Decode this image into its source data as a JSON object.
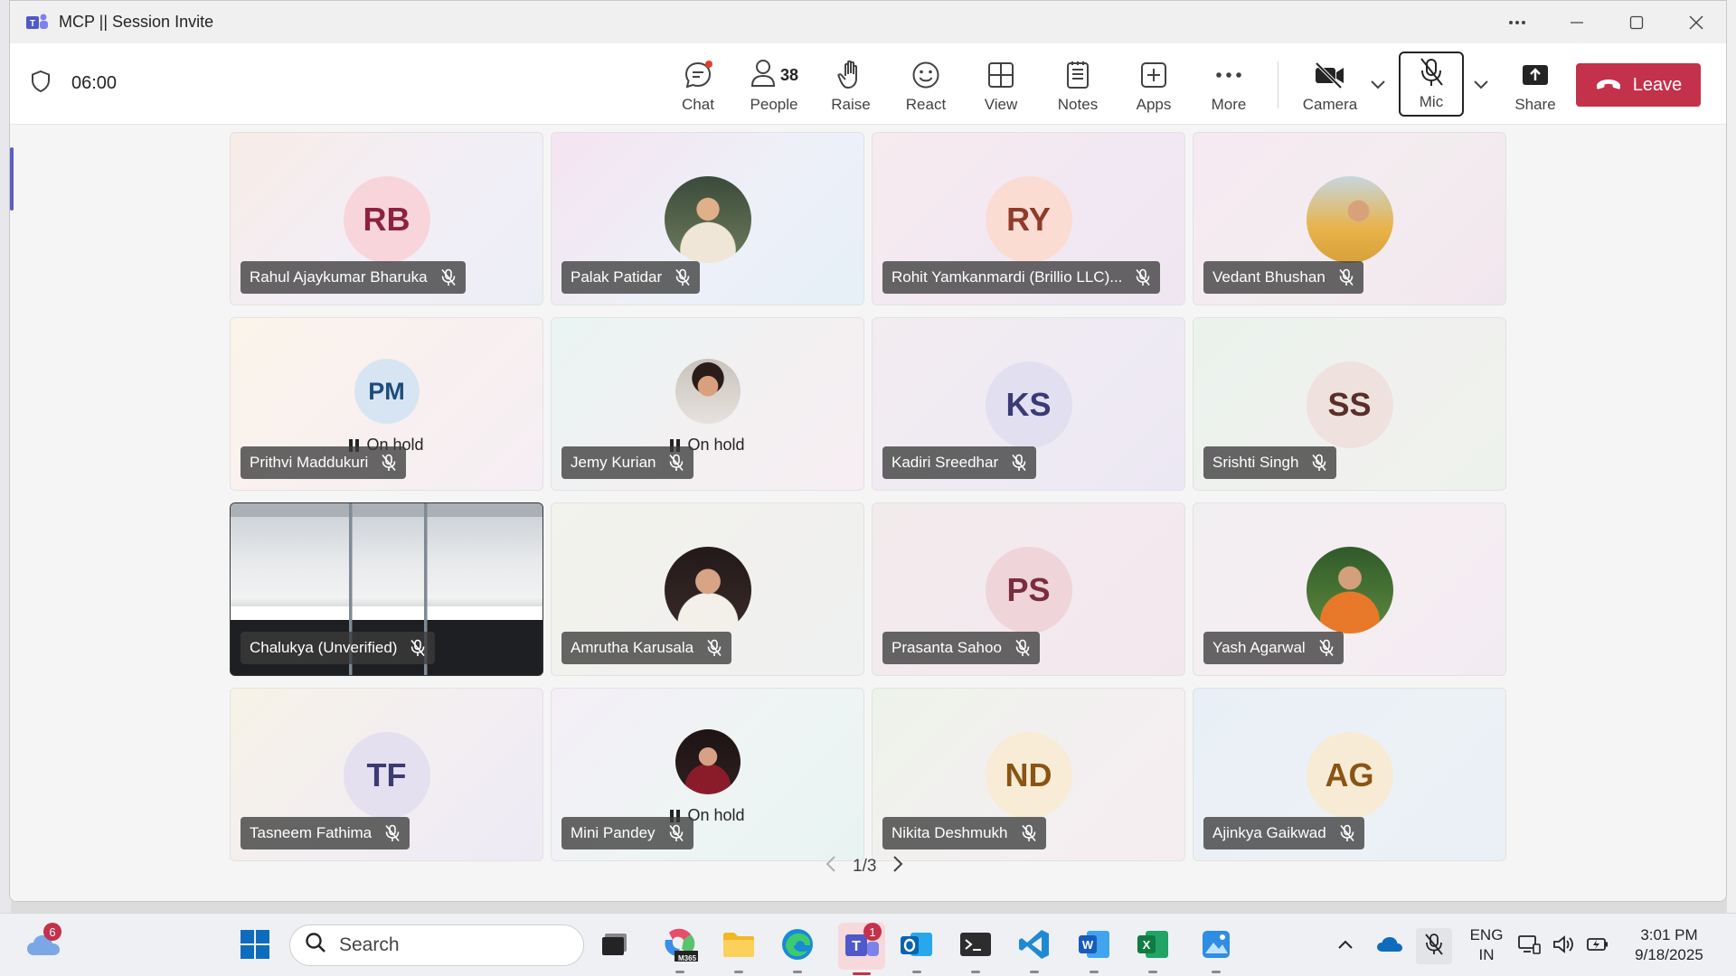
{
  "window": {
    "title": "MCP || Session Invite",
    "controls": [
      "more-options",
      "minimize",
      "maximize",
      "close"
    ]
  },
  "meeting": {
    "timer": "06:00",
    "toolbar": {
      "chat": "Chat",
      "people": "People",
      "people_count": "38",
      "raise": "Raise",
      "react": "React",
      "view": "View",
      "notes": "Notes",
      "apps": "Apps",
      "more": "More",
      "camera": "Camera",
      "mic": "Mic",
      "share": "Share",
      "leave": "Leave"
    },
    "colors": {
      "leave": "#c4314b",
      "accent": "#5b5fc7"
    }
  },
  "participants": [
    {
      "name": "Rahul Ajaykumar Bharuka",
      "initials": "RB",
      "avatar_type": "initials",
      "on_hold": false,
      "muted": true
    },
    {
      "name": "Palak Patidar",
      "initials": "",
      "avatar_type": "photo",
      "on_hold": false,
      "muted": true
    },
    {
      "name": "Rohit Yamkanmardi (Brillio LLC)...",
      "initials": "RY",
      "avatar_type": "initials",
      "on_hold": false,
      "muted": true
    },
    {
      "name": "Vedant Bhushan",
      "initials": "",
      "avatar_type": "photo",
      "on_hold": false,
      "muted": true
    },
    {
      "name": "Prithvi Maddukuri",
      "initials": "PM",
      "avatar_type": "initials",
      "on_hold": true,
      "muted": true
    },
    {
      "name": "Jemy Kurian",
      "initials": "",
      "avatar_type": "photo",
      "on_hold": true,
      "muted": true
    },
    {
      "name": "Kadiri Sreedhar",
      "initials": "KS",
      "avatar_type": "initials",
      "on_hold": false,
      "muted": true
    },
    {
      "name": "Srishti Singh",
      "initials": "SS",
      "avatar_type": "initials",
      "on_hold": false,
      "muted": true
    },
    {
      "name": "Chalukya (Unverified)",
      "initials": "",
      "avatar_type": "video",
      "on_hold": false,
      "muted": true
    },
    {
      "name": "Amrutha Karusala",
      "initials": "",
      "avatar_type": "photo",
      "on_hold": false,
      "muted": true
    },
    {
      "name": "Prasanta Sahoo",
      "initials": "PS",
      "avatar_type": "initials",
      "on_hold": false,
      "muted": true
    },
    {
      "name": "Yash Agarwal",
      "initials": "",
      "avatar_type": "photo",
      "on_hold": false,
      "muted": true
    },
    {
      "name": "Tasneem Fathima",
      "initials": "TF",
      "avatar_type": "initials",
      "on_hold": false,
      "muted": true
    },
    {
      "name": "Mini Pandey",
      "initials": "",
      "avatar_type": "photo",
      "on_hold": true,
      "muted": true
    },
    {
      "name": "Nikita Deshmukh",
      "initials": "ND",
      "avatar_type": "initials",
      "on_hold": false,
      "muted": true
    },
    {
      "name": "Ajinkya Gaikwad",
      "initials": "AG",
      "avatar_type": "initials",
      "on_hold": false,
      "muted": true
    }
  ],
  "on_hold_label": "On hold",
  "pager": {
    "label": "1/3"
  },
  "taskbar": {
    "weather_badge": "6",
    "search_placeholder": "Search",
    "teams_badge": "1",
    "m365_label": "M365",
    "language": "ENG",
    "region": "IN",
    "time": "3:01 PM",
    "date": "9/18/2025"
  }
}
